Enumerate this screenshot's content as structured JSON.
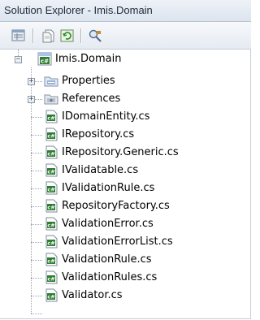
{
  "window": {
    "title": "Solution Explorer - Imis.Domain"
  },
  "toolbar": {
    "buttons": [
      {
        "name": "properties-icon"
      },
      {
        "name": "show-all-files-icon"
      },
      {
        "name": "refresh-icon"
      },
      {
        "name": "class-view-icon"
      }
    ]
  },
  "tree": {
    "project": {
      "label": "Imis.Domain",
      "icon": "csharp-project-icon",
      "expanded": true
    },
    "folders": [
      {
        "label": "Properties",
        "icon": "properties-folder-icon",
        "expanded": false
      },
      {
        "label": "References",
        "icon": "references-folder-icon",
        "expanded": false
      }
    ],
    "files": [
      {
        "label": "IDomainEntity.cs",
        "icon": "csharp-file-icon"
      },
      {
        "label": "IRepository.cs",
        "icon": "csharp-file-icon"
      },
      {
        "label": "IRepository.Generic.cs",
        "icon": "csharp-file-icon"
      },
      {
        "label": "IValidatable.cs",
        "icon": "csharp-file-icon"
      },
      {
        "label": "IValidationRule.cs",
        "icon": "csharp-file-icon"
      },
      {
        "label": "RepositoryFactory.cs",
        "icon": "csharp-file-icon"
      },
      {
        "label": "ValidationError.cs",
        "icon": "csharp-file-icon"
      },
      {
        "label": "ValidationErrorList.cs",
        "icon": "csharp-file-icon"
      },
      {
        "label": "ValidationRule.cs",
        "icon": "csharp-file-icon"
      },
      {
        "label": "ValidationRules.cs",
        "icon": "csharp-file-icon"
      },
      {
        "label": "Validator.cs",
        "icon": "csharp-file-icon"
      }
    ],
    "expander_collapsed_glyph": "+",
    "expander_expanded_glyph": "−"
  },
  "colors": {
    "title_text": "#1e2a3a",
    "csharp_badge": "#2f7d32"
  }
}
